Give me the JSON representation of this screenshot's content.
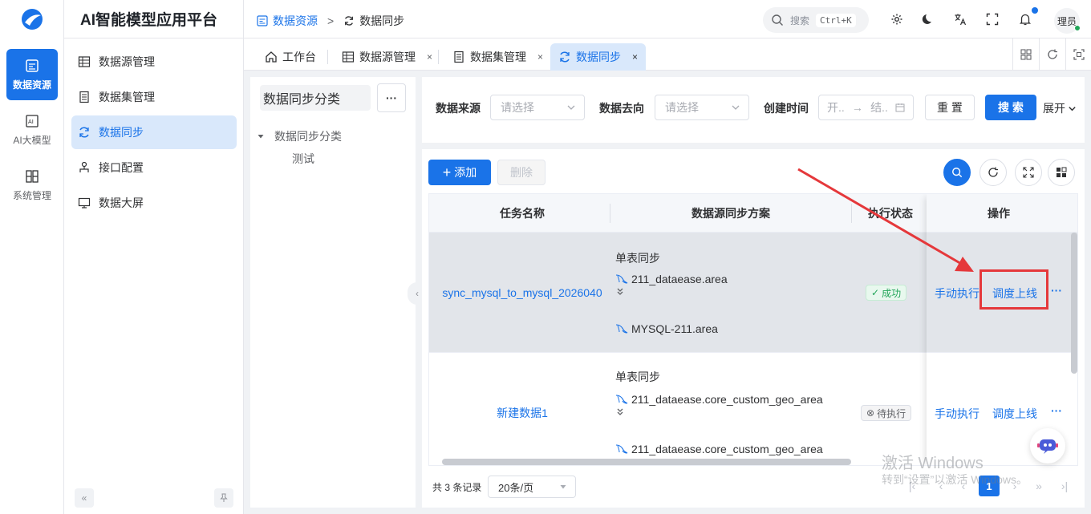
{
  "app": {
    "title": "AI智能模型应用平台"
  },
  "rail": {
    "items": [
      {
        "label": "数据资源",
        "icon": "database-icon",
        "active": true
      },
      {
        "label": "AI大模型",
        "icon": "ai-chip-icon",
        "active": false
      },
      {
        "label": "系统管理",
        "icon": "system-grid-icon",
        "active": false
      }
    ]
  },
  "submenu": {
    "items": [
      {
        "label": "数据源管理",
        "icon": "datasource-icon"
      },
      {
        "label": "数据集管理",
        "icon": "dataset-icon"
      },
      {
        "label": "数据同步",
        "icon": "sync-icon",
        "active": true
      },
      {
        "label": "接口配置",
        "icon": "interface-icon"
      },
      {
        "label": "数据大屏",
        "icon": "monitor-icon"
      }
    ],
    "collapse_glyph": "«",
    "pin_glyph": "⚲"
  },
  "header": {
    "breadcrumb": [
      "数据资源",
      "数据同步"
    ],
    "breadcrumb_sep": ">",
    "search_label": "搜索",
    "search_shortcut": "Ctrl+K",
    "user_label": "理员"
  },
  "tabs": [
    {
      "label": "工作台",
      "icon": "home-icon",
      "closable": false
    },
    {
      "label": "数据源管理",
      "icon": "datasource-icon",
      "closable": true
    },
    {
      "label": "数据集管理",
      "icon": "dataset-icon",
      "closable": true
    },
    {
      "label": "数据同步",
      "icon": "sync-icon",
      "closable": true,
      "active": true
    }
  ],
  "tab_close_glyph": "×",
  "tree": {
    "title": "数据同步分类",
    "more_glyph": "···",
    "root": "数据同步分类",
    "children": [
      "测试"
    ]
  },
  "filters": {
    "source_label": "数据来源",
    "source_placeholder": "请选择",
    "target_label": "数据去向",
    "target_placeholder": "请选择",
    "time_label": "创建时间",
    "time_start": "开..",
    "time_arrow": "→",
    "time_end": "结..",
    "reset": "重 置",
    "search": "搜 索",
    "expand": "展开"
  },
  "toolbar": {
    "add": "添加",
    "add_glyph": "+",
    "delete": "删除"
  },
  "table": {
    "columns": [
      "任务名称",
      "数据源同步方案",
      "执行状态",
      "操作"
    ],
    "rows": [
      {
        "name": "sync_mysql_to_mysql_2026040",
        "plan_type": "单表同步",
        "source": "211_dataease.area",
        "target": "MYSQL-211.area",
        "status": "成功",
        "status_kind": "ok",
        "status_glyph": "✓",
        "actions": [
          "手动执行",
          "调度上线",
          "···"
        ]
      },
      {
        "name": "新建数据1",
        "plan_type": "单表同步",
        "source": "211_dataease.core_custom_geo_area",
        "target": "211_dataease.core_custom_geo_area",
        "status": "待执行",
        "status_kind": "wait",
        "status_glyph": "⊗",
        "actions": [
          "手动执行",
          "调度上线",
          "···"
        ]
      }
    ],
    "arrow_glyph": "↓"
  },
  "pagination": {
    "total": "共 3 条记录",
    "page_size": "20条/页",
    "current": "1",
    "first": "|‹",
    "prev": "‹",
    "next": "›",
    "fast_next": "»",
    "last": "›|"
  },
  "watermark": {
    "line1": "激活 Windows",
    "line2": "转到“设置”以激活 Windows。"
  },
  "colors": {
    "accent": "#1a73e8",
    "highlight": "#e5383b",
    "success": "#22a559"
  }
}
